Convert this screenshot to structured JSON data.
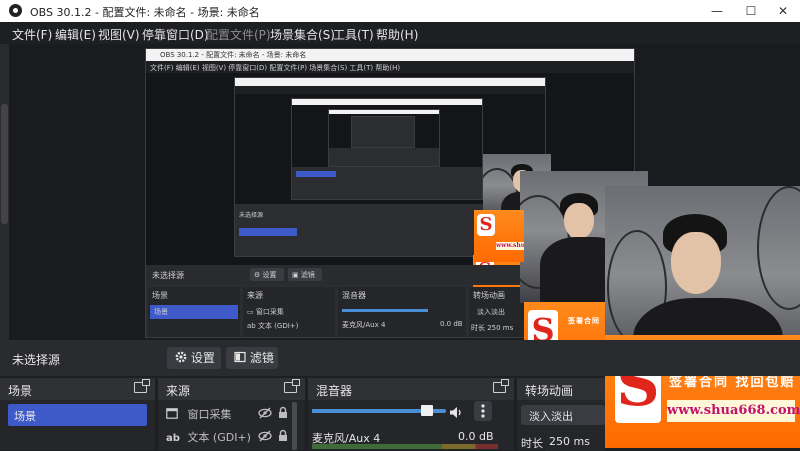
{
  "window": {
    "title": "OBS 30.1.2 - 配置文件: 未命名 - 场景: 未命名",
    "controls": [
      "—",
      "☐",
      "✕"
    ]
  },
  "menu": [
    "文件(F)",
    "编辑(E)",
    "视图(V)",
    "停靠窗口(D)",
    "配置文件(P)",
    "场景集合(S)",
    "工具(T)",
    "帮助(H)"
  ],
  "context_bar": {
    "no_source": "未选择源",
    "settings_label": "设置",
    "filters_label": "滤镜"
  },
  "scenes": {
    "title": "场景",
    "items": [
      "场景"
    ]
  },
  "sources": {
    "title": "来源",
    "items": [
      {
        "icon": "window-capture-icon",
        "label": "窗口采集"
      },
      {
        "icon": "text-icon",
        "label": "文本 (GDI+)"
      }
    ]
  },
  "mixer": {
    "title": "混音器",
    "channel_name": "麦克风/Aux 4",
    "level": "0.0 dB",
    "volume_fraction": 0.86
  },
  "transitions": {
    "title": "转场动画",
    "selected": "淡入淡出",
    "duration_label": "时长",
    "duration_value": "250 ms"
  },
  "overlay_ad": {
    "logo_letter": "S",
    "slogan": "签署合同 找回包赔",
    "url": "www.shua668.com"
  },
  "colors": {
    "accent": "#3d5ac8",
    "background": "#1e1f22",
    "panel": "#25262a",
    "panel_header": "#303135",
    "ad_orange": "#ff6a00",
    "ad_url": "#c2126b"
  }
}
